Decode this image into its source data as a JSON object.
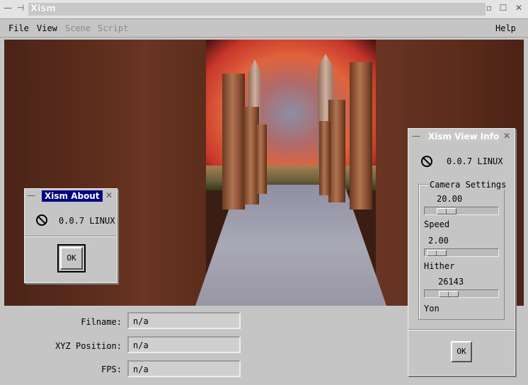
{
  "window": {
    "title": "Xism",
    "menu": [
      "File",
      "View",
      "Scene",
      "Script"
    ],
    "help": "Help"
  },
  "info": {
    "filename_label": "Filname:",
    "filename_value": "n/a",
    "position_label": "XYZ Position:",
    "position_value": "n/a",
    "fps_label": "FPS:",
    "fps_value": "n/a"
  },
  "about": {
    "title": "Xism About",
    "version": "0.0.7 LINUX",
    "ok": "OK"
  },
  "viewinfo": {
    "title": "Xism View Info",
    "version": "0.0.7 LINUX",
    "group_label": "Camera Settings",
    "speed_value": "20.00",
    "speed_label": "Speed",
    "hither_value": "2.00",
    "hither_label": "Hither",
    "yon_value": "26143",
    "yon_label": "Yon",
    "ok": "OK"
  },
  "icons": [
    "window-menu-icon",
    "pin-icon",
    "minimize-icon",
    "maximize-icon",
    "close-icon",
    "stop-icon"
  ]
}
